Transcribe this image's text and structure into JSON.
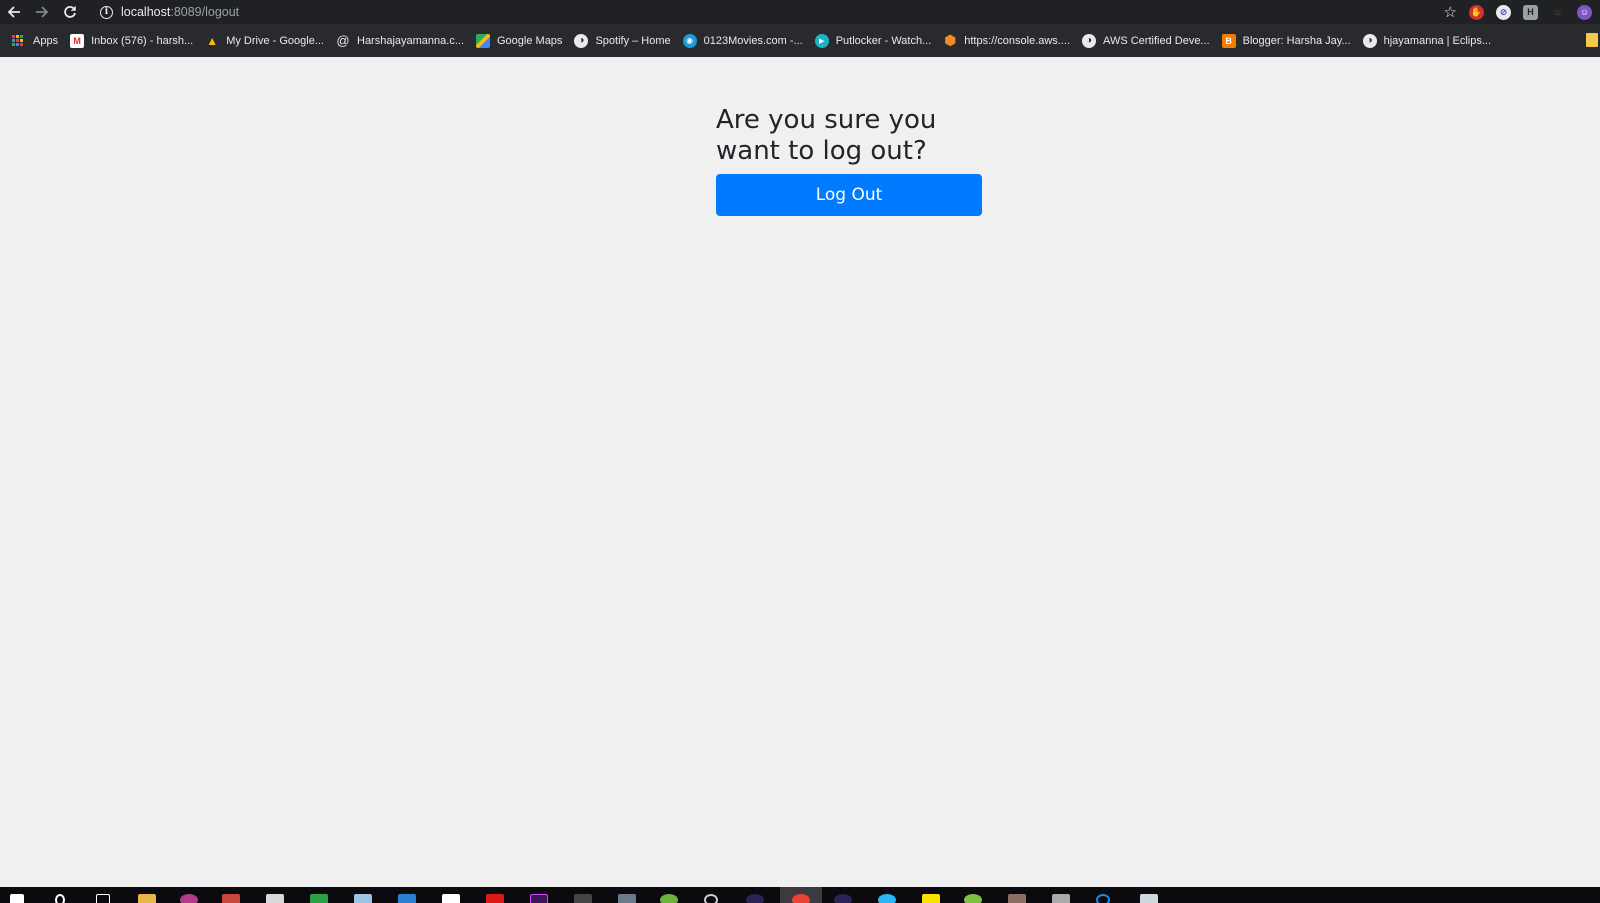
{
  "browser": {
    "url_host": "localhost",
    "url_rest": ":8089/logout"
  },
  "bookmarks": [
    {
      "label": "Apps",
      "icon": "apps-grid-icon"
    },
    {
      "label": "Inbox (576) - harsh...",
      "icon": "gmail-icon",
      "color": "#d93025",
      "glyph": "M"
    },
    {
      "label": "My Drive - Google...",
      "icon": "drive-icon",
      "color": "#1fa463",
      "glyph": "▲"
    },
    {
      "label": "Harshajayamanna.c...",
      "icon": "at-icon",
      "color": "transparent",
      "glyph": "@"
    },
    {
      "label": "Google Maps",
      "icon": "maps-icon",
      "color": "#34a853",
      "glyph": "◆"
    },
    {
      "label": "Spotify – Home",
      "icon": "globe-icon",
      "color": "transparent",
      "glyph": "◐"
    },
    {
      "label": "0123Movies.com -...",
      "icon": "movies-icon",
      "color": "#1a9bd7",
      "glyph": "●"
    },
    {
      "label": "Putlocker - Watch...",
      "icon": "play-icon",
      "color": "#20b2c4",
      "glyph": "▶"
    },
    {
      "label": "https://console.aws....",
      "icon": "aws-cube-icon",
      "color": "#f28c28",
      "glyph": "⬢"
    },
    {
      "label": "AWS Certified Deve...",
      "icon": "globe-icon",
      "color": "transparent",
      "glyph": "◐"
    },
    {
      "label": "Blogger: Harsha Jay...",
      "icon": "blogger-icon",
      "color": "#f57d00",
      "glyph": "B"
    },
    {
      "label": "hjayamanna | Eclips...",
      "icon": "globe-icon",
      "color": "transparent",
      "glyph": "◐"
    }
  ],
  "page": {
    "title": "Are you sure you want to log out?",
    "button_label": "Log Out"
  },
  "colors": {
    "primary_button": "#007bff",
    "page_background": "#f0f0f0",
    "title_text": "#212529"
  }
}
